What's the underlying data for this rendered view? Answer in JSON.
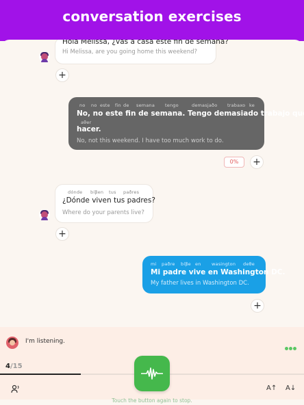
{
  "header": {
    "title": "conversation exercises"
  },
  "messages": [
    {
      "id": "m1",
      "spanish": "Hola Melissa, ¿vas a casa este fin de semana?",
      "english": "Hi Melissa, are you going home this weekend?"
    },
    {
      "id": "m2",
      "phonetic": [
        "no",
        "no",
        "este",
        "fin",
        "de",
        "semana",
        "tengo",
        "demasjaðo",
        "trabaxo",
        "ke",
        "aθer"
      ],
      "spanish_line1": "No, no este fin de semana. Tengo demasiado trabajo que",
      "spanish_line2": "hacer.",
      "english": "No, not this weekend. I have too much work to do.",
      "score": "0%"
    },
    {
      "id": "m3",
      "phonetic": [
        "dónde",
        "bíβen",
        "tus",
        "paðres"
      ],
      "spanish": "¿Dónde viven tus padres?",
      "english": "Where do your parents live?"
    },
    {
      "id": "m4",
      "phonetic": [
        "mi",
        "paðre",
        "bíβe",
        "en",
        "wasington",
        "deθe"
      ],
      "spanish": "Mi padre vive en Washington DC.",
      "english": "My father lives in Washington DC."
    }
  ],
  "listening": {
    "status": "I'm listening.",
    "progress_current": "4",
    "progress_total": "/15",
    "progress_fraction": 0.2667,
    "hint": "Touch the button again to stop."
  },
  "toolbar": {
    "font_up": "A↑",
    "font_down": "A↓"
  },
  "colors": {
    "header": "#a112e8",
    "user_bubble": "#666666",
    "tutor_reply": "#1aa0e6",
    "mic_button": "#45b84c"
  },
  "icons": [
    "plus-icon",
    "microphone-icon",
    "voice-settings-icon",
    "font-increase-icon",
    "font-decrease-icon",
    "more-dots-icon"
  ]
}
